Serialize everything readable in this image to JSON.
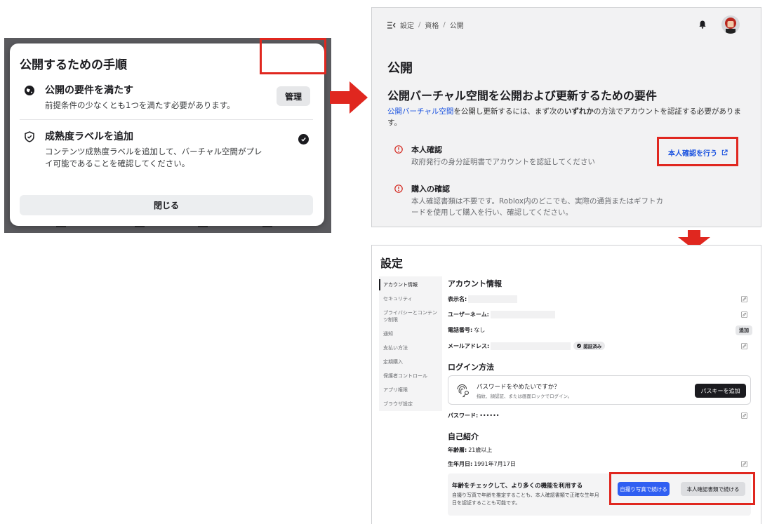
{
  "modal": {
    "title": "公開するための手順",
    "steps": [
      {
        "icon": "globe-icon",
        "title": "公開の要件を満たす",
        "desc": "前提条件の少なくとも1つを満たす必要があります。"
      },
      {
        "icon": "shield-icon",
        "title": "成熟度ラベルを追加",
        "desc": "コンテンツ成熟度ラベルを追加して、バーチャル空間がプレイ可能であることを確認してください。"
      }
    ],
    "manage_label": "管理",
    "close_label": "閉じる"
  },
  "publish_page": {
    "breadcrumb": [
      "設定",
      "資格",
      "公開"
    ],
    "page_title": "公開",
    "requirements_title": "公開バーチャル空間を公開および更新するための要件",
    "desc_link": "公開バーチャル空間",
    "desc_mid": "を公開し更新するには、まず次の",
    "desc_bold": "いずれか",
    "desc_end": "の方法でアカウントを認証する必要があります。",
    "options": [
      {
        "title": "本人確認",
        "desc": "政府発行の身分証明書でアカウントを認証してください"
      },
      {
        "title": "購入の確認",
        "desc": "本人確認書類は不要です。Roblox内のどこでも、実際の通貨またはギフトカードを使用して購入を行い、確認してください。"
      }
    ],
    "verify_label": "本人確認を行う"
  },
  "settings": {
    "title": "設定",
    "sidebar": [
      "アカウント情報",
      "セキュリティ",
      "プライバシーとコンテンツ制限",
      "通知",
      "支払い方法",
      "定期購入",
      "保護者コントロール",
      "アプリ権限",
      "ブラウザ設定"
    ],
    "account_section": "アカウント情報",
    "display_name_label": "表示名:",
    "username_label": "ユーザーネーム:",
    "phone_label": "電話番号:",
    "phone_value": "なし",
    "add_label": "追加",
    "email_label": "メールアドレス:",
    "verified_label": "認証済み",
    "login_section": "ログイン方法",
    "passkey_question": "パスワードをやめたいですか？",
    "passkey_sub": "指紋、顔認証、または画面ロックでログイン。",
    "passkey_button": "パスキーを追加",
    "password_label": "パスワード:",
    "password_value": "••••••",
    "bio_section": "自己紹介",
    "age_label": "年齢層:",
    "age_value": "21歳以上",
    "birthday_label": "生年月日:",
    "birthday_value": "1991年7月17日",
    "age_check_title": "年齢をチェックして、より多くの機能を利用する",
    "age_check_desc": "自撮り写真で年齢を推定することも、本人確認書類で正確な生年月日を認証することも可能です。",
    "selfie_button": "自撮り写真で続ける",
    "id_button": "本人確認書類で続ける"
  },
  "colors": {
    "highlight": "#e0271f",
    "link": "#1e55e0",
    "primary": "#2f5ff2"
  }
}
